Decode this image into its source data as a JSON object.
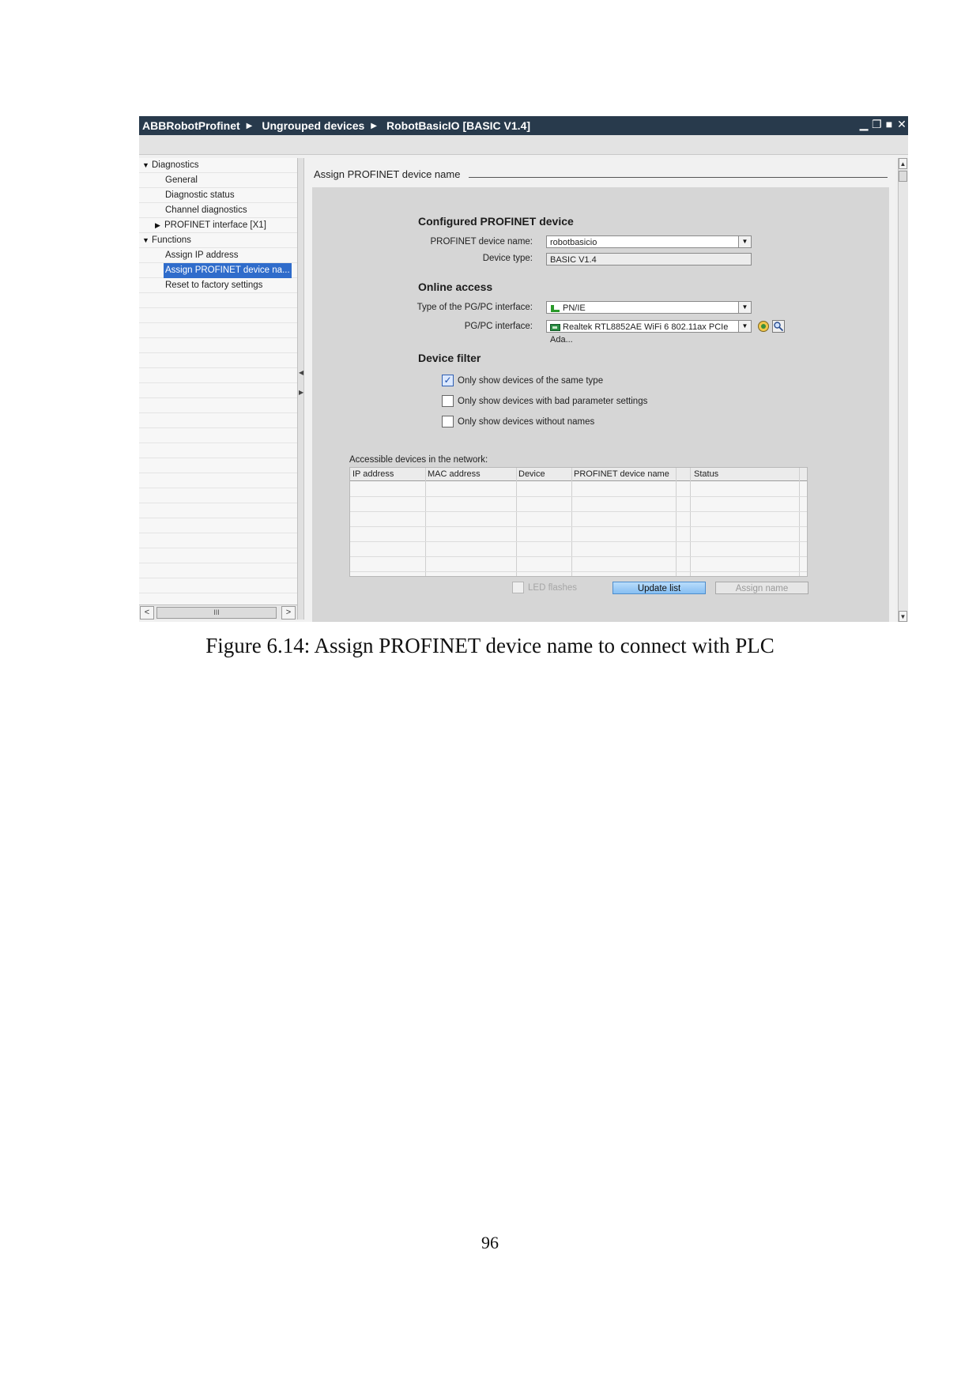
{
  "window": {
    "breadcrumbs": [
      "ABBRobotProfinet",
      "Ungrouped devices",
      "RobotBasicIO [BASIC V1.4]"
    ],
    "controls": [
      "minimize",
      "restore",
      "maximize",
      "close"
    ]
  },
  "tree": {
    "items": [
      {
        "label": "Diagnostics",
        "expander": "▼"
      },
      {
        "label": "General"
      },
      {
        "label": "Diagnostic status"
      },
      {
        "label": "Channel diagnostics"
      },
      {
        "label": "PROFINET interface [X1]",
        "expander": "▶"
      },
      {
        "label": "Functions",
        "expander": "▼"
      },
      {
        "label": "Assign IP address"
      },
      {
        "label": "Assign PROFINET device na...",
        "selected": true
      },
      {
        "label": "Reset to factory settings"
      }
    ],
    "scroll_thumb": "III"
  },
  "main": {
    "section_title": "Assign PROFINET device name",
    "configured": {
      "heading": "Configured PROFINET device",
      "name_label": "PROFINET device name:",
      "name_value": "robotbasicio",
      "type_label": "Device type:",
      "type_value": "BASIC V1.4"
    },
    "online": {
      "heading": "Online access",
      "iface_type_label": "Type of the PG/PC interface:",
      "iface_type_value": "PN/IE",
      "iface_label": "PG/PC interface:",
      "iface_value": "Realtek RTL8852AE WiFi 6 802.11ax PCIe Ada..."
    },
    "filter": {
      "heading": "Device filter",
      "options": [
        {
          "label": "Only show devices of the same type",
          "checked": true
        },
        {
          "label": "Only show devices with bad parameter settings",
          "checked": false
        },
        {
          "label": "Only show devices without names",
          "checked": false
        }
      ]
    },
    "table": {
      "caption": "Accessible devices in the network:",
      "columns": [
        "IP address",
        "MAC address",
        "Device",
        "PROFINET device name",
        "Status"
      ],
      "rows": []
    },
    "led_label": "LED flashes",
    "update_button": "Update list",
    "assign_button": "Assign name"
  },
  "caption": "Figure 6.14: Assign PROFINET device name to connect with PLC",
  "page_number": "96",
  "colors": {
    "titlebar": "#283a4c",
    "selection": "#2f6ccb",
    "update_button": "#86bff2"
  }
}
